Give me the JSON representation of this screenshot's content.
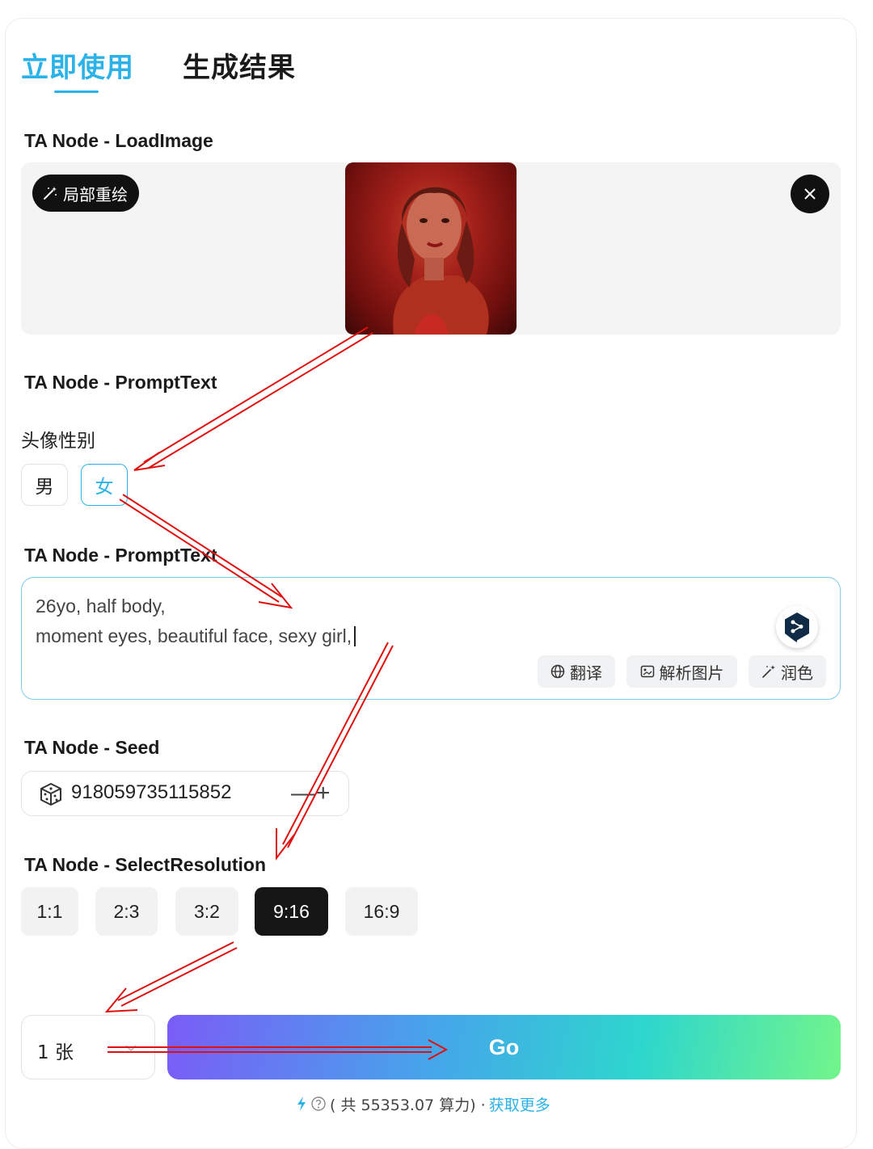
{
  "tabs": [
    {
      "label": "立即使用",
      "active": true
    },
    {
      "label": "生成结果",
      "active": false
    }
  ],
  "load_image": {
    "section_label": "TA Node - LoadImage",
    "inpaint_badge": "局部重绘"
  },
  "gender": {
    "section_label": "TA Node - PromptText",
    "field_label": "头像性别",
    "options": [
      "男",
      "女"
    ],
    "selected": "女"
  },
  "prompt": {
    "section_label": "TA Node - PromptText",
    "text": "26yo, half body,\nmoment eyes, beautiful face, sexy girl,",
    "tools": [
      "翻译",
      "解析图片",
      "润色"
    ]
  },
  "seed": {
    "section_label": "TA Node - Seed",
    "value": "918059735115852",
    "minus": "—",
    "plus": "+"
  },
  "resolution": {
    "section_label": "TA Node - SelectResolution",
    "options": [
      "1:1",
      "2:3",
      "3:2",
      "9:16",
      "16:9"
    ],
    "selected": "9:16"
  },
  "generate": {
    "count_label": "1 张",
    "go_label": "Go"
  },
  "footer": {
    "credits_text": "( 共 55353.07 算力) ·",
    "more_link": "获取更多"
  },
  "colors": {
    "accent": "#2bb2e8",
    "annotation_arrow": "#e01010"
  }
}
